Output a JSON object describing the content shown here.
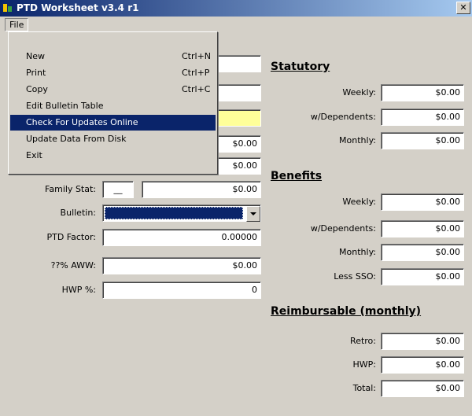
{
  "window": {
    "title": "PTD Worksheet v3.4 r1",
    "close_glyph": "✕"
  },
  "menubar": {
    "file": "File"
  },
  "file_menu": [
    {
      "label": "New",
      "shortcut": "Ctrl+N"
    },
    {
      "label": "Print",
      "shortcut": "Ctrl+P"
    },
    {
      "label": "Copy",
      "shortcut": "Ctrl+C"
    },
    {
      "label": "Edit Bulletin Table",
      "shortcut": ""
    },
    {
      "label": "Check For Updates Online",
      "shortcut": ""
    },
    {
      "label": "Update Data From Disk",
      "shortcut": ""
    },
    {
      "label": "Exit",
      "shortcut": ""
    }
  ],
  "left": {
    "hidden_fields": [
      "",
      "",
      "",
      "$0.00",
      "$0.00"
    ],
    "family_stat": {
      "label": "Family Stat:",
      "code": "__",
      "value": "$0.00"
    },
    "bulletin": {
      "label": "Bulletin:",
      "value": ""
    },
    "ptd_factor": {
      "label": "PTD Factor:",
      "value": "0.00000"
    },
    "aww": {
      "label": "??% AWW:",
      "value": "$0.00"
    },
    "hwp": {
      "label": "HWP %:",
      "value": "0"
    }
  },
  "statutory": {
    "heading": "Statutory",
    "rows": [
      {
        "label": "Weekly:",
        "value": "$0.00"
      },
      {
        "label": "w/Dependents:",
        "value": "$0.00"
      },
      {
        "label": "Monthly:",
        "value": "$0.00"
      }
    ]
  },
  "benefits": {
    "heading": "Benefits",
    "rows": [
      {
        "label": "Weekly:",
        "value": "$0.00"
      },
      {
        "label": "w/Dependents:",
        "value": "$0.00"
      },
      {
        "label": "Monthly:",
        "value": "$0.00"
      },
      {
        "label": "Less SSO:",
        "value": "$0.00"
      }
    ]
  },
  "reimbursable": {
    "heading": "Reimbursable (monthly)",
    "rows": [
      {
        "label": "Retro:",
        "value": "$0.00"
      },
      {
        "label": "HWP:",
        "value": "$0.00"
      },
      {
        "label": "Total:",
        "value": "$0.00"
      }
    ]
  },
  "colors": {
    "highlight_field": "#ffff99",
    "selection": "#0a246a"
  }
}
